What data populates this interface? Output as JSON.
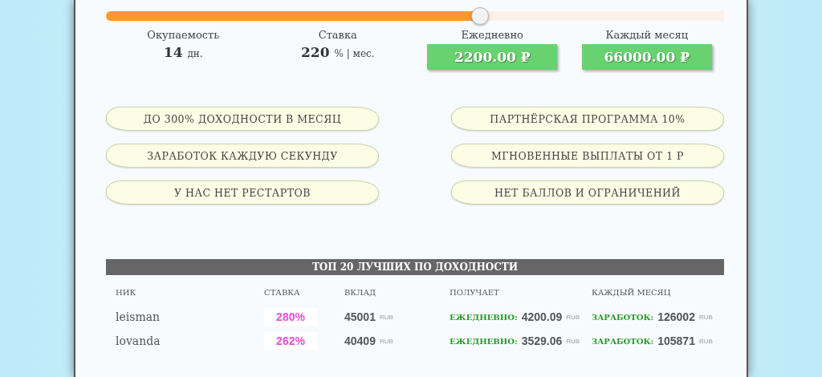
{
  "slider": {
    "level": 0.605
  },
  "stats": [
    {
      "kind": "plain",
      "label": "Окупаемость",
      "value": "14",
      "unit": "дн."
    },
    {
      "kind": "plain",
      "label": "Ставка",
      "value": "220",
      "unit": "% | мес."
    },
    {
      "kind": "highlight",
      "label": "Ежедневно",
      "value": "2200.00 ₽"
    },
    {
      "kind": "highlight",
      "label": "Каждый месяц",
      "value": "66000.00 ₽"
    }
  ],
  "features": [
    "ДО 300% ДОХОДНОСТИ В МЕСЯЦ",
    "ПАРТНЁРСКАЯ ПРОГРАММА 10%",
    "ЗАРАБОТОК КАЖДУЮ СЕКУНДУ",
    "МГНОВЕННЫЕ ВЫПЛАТЫ ОТ 1 Р",
    "У НАС НЕТ РЕСТАРТОВ",
    "НЕТ БАЛЛОВ И ОГРАНИЧЕНИЙ"
  ],
  "table": {
    "title": "ТОП 20 ЛУЧШИХ ПО ДОХОДНОСТИ",
    "columns": [
      "НИК",
      "СТАВКА",
      "ВКЛАД",
      "ПОЛУЧАЕТ",
      "КАЖДЫЙ МЕСЯЦ"
    ],
    "rows": [
      {
        "nick": "leisman",
        "rate": "280%",
        "deposit": "45001",
        "deposit_unit": "RUB",
        "daily_label": "ЕЖЕДНЕВНО:",
        "daily": "4200.09",
        "daily_unit": "RUB",
        "monthly_label": "ЗАРАБОТОК:",
        "monthly": "126002",
        "monthly_unit": "RUB"
      },
      {
        "nick": "lovanda",
        "rate": "262%",
        "deposit": "40409",
        "deposit_unit": "RUB",
        "daily_label": "ЕЖЕДНЕВНО:",
        "daily": "3529.06",
        "daily_unit": "RUB",
        "monthly_label": "ЗАРАБОТОК:",
        "monthly": "105871",
        "monthly_unit": "RUB"
      }
    ]
  }
}
